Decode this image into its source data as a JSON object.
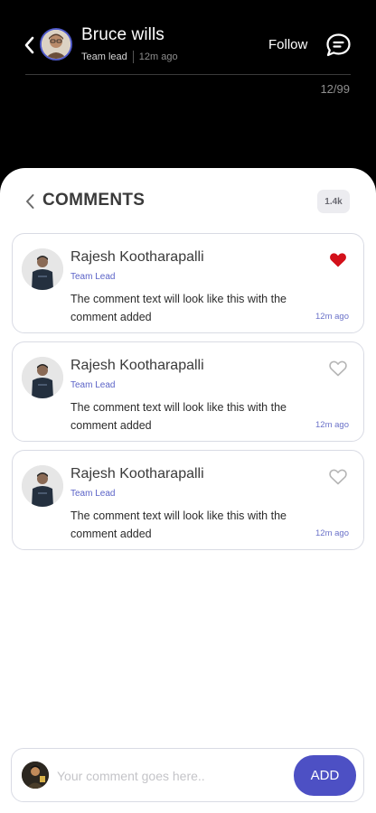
{
  "header": {
    "name": "Bruce wills",
    "role": "Team lead",
    "time": "12m ago",
    "follow_label": "Follow",
    "counter": "12/99",
    "icons": {
      "back": "chevron-left-icon",
      "chat": "chat-bubble-icon"
    }
  },
  "comments_header": {
    "title": "COMMENTS",
    "count": "1.4k"
  },
  "comments": [
    {
      "name": "Rajesh Kootharapalli",
      "role": "Team Lead",
      "text": "The comment text will look like this with the comment added",
      "time": "12m ago",
      "liked": true
    },
    {
      "name": "Rajesh Kootharapalli",
      "role": "Team Lead",
      "text": "The comment text will look like this with the comment added",
      "time": "12m ago",
      "liked": false
    },
    {
      "name": "Rajesh Kootharapalli",
      "role": "Team Lead",
      "text": "The comment text will look like this with the comment added",
      "time": "12m ago",
      "liked": false
    }
  ],
  "composer": {
    "placeholder": "Your comment goes here..",
    "value": "",
    "add_label": "ADD"
  },
  "colors": {
    "accent": "#4d50c4",
    "like_active": "#d3101a",
    "like_inactive": "#b5b5b5",
    "role_text": "#5b63c7"
  }
}
